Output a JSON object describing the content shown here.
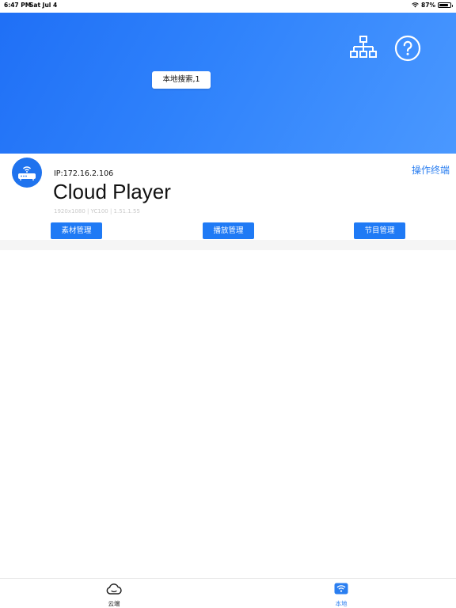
{
  "status_bar": {
    "time": "6:47 PM",
    "date": "Sat Jul 4",
    "battery": "87%"
  },
  "header": {
    "search_chip": "本地搜索,1",
    "icons": [
      "network-topology-icon",
      "help-icon"
    ]
  },
  "device": {
    "ip": "IP:172.16.2.106",
    "name": "Cloud Player",
    "meta": "1920x1080 | YC100 | 1.51.1.55",
    "operate_link": "操作终端",
    "avatar_icon": "router-icon"
  },
  "actions": {
    "material": "素材管理",
    "playback": "播放管理",
    "program": "节目管理"
  },
  "tabs": {
    "cloud": "云端",
    "local": "本地",
    "active": "local"
  },
  "colors": {
    "accent": "#1f7af5",
    "header_start": "#1f6ff6",
    "header_end": "#4a98ff"
  }
}
